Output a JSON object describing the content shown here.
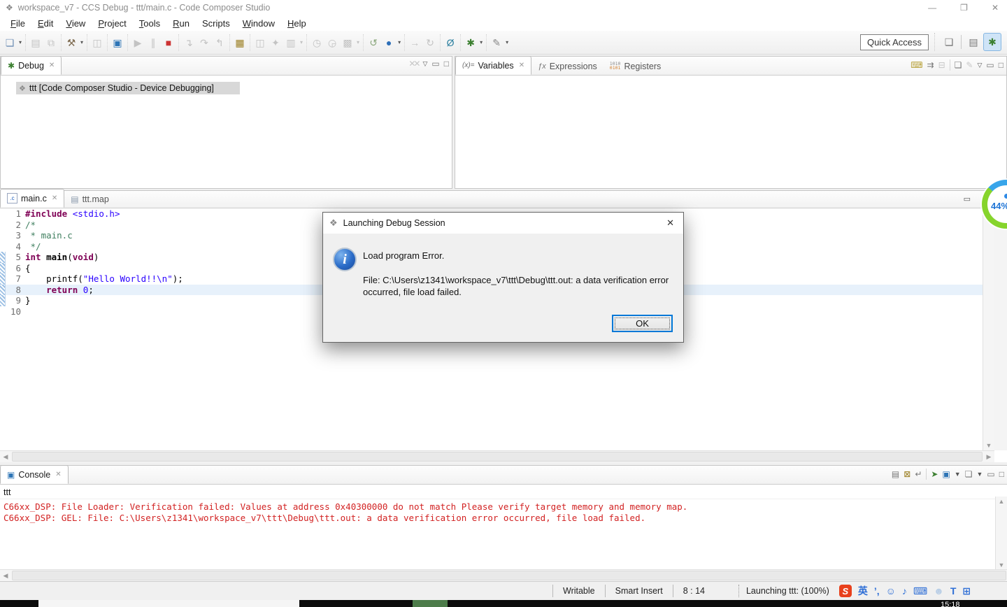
{
  "window": {
    "title": "workspace_v7 - CCS Debug - ttt/main.c - Code Composer Studio",
    "controls": {
      "minimize": "—",
      "maximize": "❐",
      "close": "✕"
    }
  },
  "menubar": [
    {
      "t": "File",
      "u": 0
    },
    {
      "t": "Edit",
      "u": 0
    },
    {
      "t": "View",
      "u": 0
    },
    {
      "t": "Project",
      "u": 0
    },
    {
      "t": "Tools",
      "u": 0
    },
    {
      "t": "Run",
      "u": 0
    },
    {
      "t": "Scripts",
      "u": -1
    },
    {
      "t": "Window",
      "u": 0
    },
    {
      "t": "Help",
      "u": 0
    }
  ],
  "toolbar": {
    "quick_access": "Quick Access",
    "groups": [
      [
        {
          "n": "new-wizard",
          "g": "❏",
          "c": "#6f8fb5",
          "dd": true
        }
      ],
      [
        {
          "n": "save",
          "g": "▤",
          "dis": true
        },
        {
          "n": "save-all",
          "g": "⧉",
          "dis": true
        }
      ],
      [
        {
          "n": "build-hammer",
          "g": "⚒",
          "c": "#7d6a4f",
          "dd": true
        }
      ],
      [
        {
          "n": "debug-config",
          "g": "◫",
          "dis": true
        }
      ],
      [
        {
          "n": "disassembly-view",
          "g": "▣",
          "c": "#2e75b6"
        }
      ],
      [
        {
          "n": "resume",
          "g": "▶",
          "dis": true
        },
        {
          "n": "suspend",
          "g": "∥",
          "dis": true
        },
        {
          "n": "terminate",
          "g": "■",
          "c": "#cc3333"
        }
      ],
      [
        {
          "n": "step-into",
          "g": "↴",
          "dis": true
        },
        {
          "n": "step-over",
          "g": "↷",
          "dis": true
        },
        {
          "n": "step-return",
          "g": "↰",
          "dis": true
        }
      ],
      [
        {
          "n": "memory-browser",
          "g": "▦",
          "c": "#9a7d1f"
        }
      ],
      [
        {
          "n": "launch-view",
          "g": "◫",
          "dis": true
        },
        {
          "n": "pin-wand",
          "g": "✦",
          "dis": true
        },
        {
          "n": "profile-window",
          "g": "▥",
          "dis": true,
          "dd": true
        }
      ],
      [
        {
          "n": "runtime-clock",
          "g": "◷",
          "dis": true
        },
        {
          "n": "runtime-clock-alt",
          "g": "◶",
          "dis": true
        },
        {
          "n": "processor-options",
          "g": "▩",
          "dis": true,
          "dd": true
        }
      ],
      [
        {
          "n": "restart",
          "g": "↺",
          "c": "#8aa77b"
        },
        {
          "n": "launch-world",
          "g": "●",
          "c": "#2d6fb8",
          "dd": true
        }
      ],
      [
        {
          "n": "step-command",
          "g": "→",
          "dis": true
        },
        {
          "n": "reset-cpu",
          "g": "↻",
          "dis": true
        }
      ],
      [
        {
          "n": "search",
          "g": "Ø",
          "c": "#2b7f9f"
        }
      ],
      [
        {
          "n": "debug-bug",
          "g": "✱",
          "c": "#3c8031",
          "dd": true
        }
      ],
      [
        {
          "n": "format-brush",
          "g": "✎",
          "c": "#888888",
          "dd": true
        }
      ]
    ],
    "perspectives": [
      {
        "n": "open-perspective",
        "g": "❏",
        "c": "#777777"
      },
      {
        "n": "ccs-edit-perspective",
        "g": "▤",
        "c": "#777777"
      },
      {
        "n": "ccs-debug-perspective",
        "g": "✱",
        "c": "#3c8031",
        "active": true
      }
    ]
  },
  "debug_panel": {
    "tab": "Debug",
    "tree_item": "ttt [Code Composer Studio - Device Debugging]"
  },
  "variables_panel": {
    "tabs": [
      {
        "label": "Variables"
      },
      {
        "label": "Expressions"
      },
      {
        "label": "Registers"
      }
    ]
  },
  "editor": {
    "tabs": [
      {
        "label": "main.c"
      },
      {
        "label": "ttt.map"
      }
    ],
    "current_line": 8,
    "range_lines": [
      5,
      9
    ],
    "lines": [
      {
        "n": 1,
        "tokens": [
          [
            "d",
            "#include"
          ],
          [
            "p",
            " "
          ],
          [
            "s",
            "<stdio.h>"
          ]
        ]
      },
      {
        "n": 2,
        "tokens": [
          [
            "c",
            "/*"
          ]
        ]
      },
      {
        "n": 3,
        "tokens": [
          [
            "c",
            " * main.c"
          ]
        ]
      },
      {
        "n": 4,
        "tokens": [
          [
            "c",
            " */"
          ]
        ]
      },
      {
        "n": 5,
        "tokens": [
          [
            "k",
            "int"
          ],
          [
            "p",
            " "
          ],
          [
            "b",
            "main"
          ],
          [
            "p",
            "("
          ],
          [
            "k",
            "void"
          ],
          [
            "p",
            ")"
          ]
        ]
      },
      {
        "n": 6,
        "tokens": [
          [
            "p",
            "{"
          ]
        ]
      },
      {
        "n": 7,
        "tokens": [
          [
            "p",
            "    printf("
          ],
          [
            "s",
            "\"Hello World!!\\n\""
          ],
          [
            "p",
            ");"
          ]
        ]
      },
      {
        "n": 8,
        "tokens": [
          [
            "p",
            "    "
          ],
          [
            "k",
            "return"
          ],
          [
            "p",
            " "
          ],
          [
            "n",
            "0"
          ],
          [
            "p",
            ";"
          ]
        ]
      },
      {
        "n": 9,
        "tokens": [
          [
            "p",
            "}"
          ]
        ]
      },
      {
        "n": 10,
        "tokens": []
      }
    ]
  },
  "dialog": {
    "title": "Launching Debug Session",
    "message_title": "Load program Error.",
    "message_body": "File: C:\\Users\\z1341\\workspace_v7\\ttt\\Debug\\ttt.out: a data verification error occurred, file load failed.",
    "ok_label": "OK",
    "info_glyph": "i",
    "close_glyph": "✕"
  },
  "console": {
    "tab": "Console",
    "name": "ttt",
    "lines": [
      "C66xx_DSP: File Loader: Verification failed: Values at address 0x40300000 do not match Please verify target memory and memory map.",
      "C66xx_DSP: GEL: File: C:\\Users\\z1341\\workspace_v7\\ttt\\Debug\\ttt.out: a data verification error occurred, file load failed.",
      ""
    ],
    "error_color": "#d22222"
  },
  "statusbar": {
    "cells": [
      {
        "n": "writable-status",
        "t": "Writable"
      },
      {
        "n": "insert-mode-status",
        "t": "Smart Insert"
      },
      {
        "n": "cursor-position-status",
        "t": "8 : 14"
      }
    ],
    "progress": "Launching ttt: (100%)",
    "sogou": [
      {
        "n": "sogou-logo",
        "g": "S",
        "badge": true
      },
      {
        "n": "language-mode",
        "g": "英"
      },
      {
        "n": "punctuation-mode",
        "g": "’,"
      },
      {
        "n": "emoji-panel",
        "g": "☺"
      },
      {
        "n": "voice-input",
        "g": "♪"
      },
      {
        "n": "soft-keyboard",
        "g": "⌨"
      },
      {
        "n": "skin-person",
        "g": "☻",
        "c": "#b9cee6"
      },
      {
        "n": "skin-shirt",
        "g": "T"
      },
      {
        "n": "toolbox-grid",
        "g": "⊞"
      }
    ]
  },
  "taskbar": {
    "clock": "15:18"
  },
  "overlay_ball": {
    "percent": "44%"
  }
}
